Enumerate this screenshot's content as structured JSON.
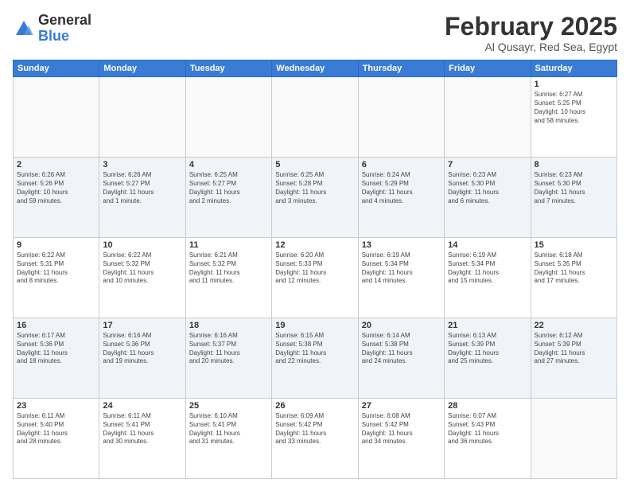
{
  "logo": {
    "general": "General",
    "blue": "Blue"
  },
  "header": {
    "title": "February 2025",
    "subtitle": "Al Qusayr, Red Sea, Egypt"
  },
  "weekdays": [
    "Sunday",
    "Monday",
    "Tuesday",
    "Wednesday",
    "Thursday",
    "Friday",
    "Saturday"
  ],
  "weeks": [
    [
      {
        "day": "",
        "info": ""
      },
      {
        "day": "",
        "info": ""
      },
      {
        "day": "",
        "info": ""
      },
      {
        "day": "",
        "info": ""
      },
      {
        "day": "",
        "info": ""
      },
      {
        "day": "",
        "info": ""
      },
      {
        "day": "1",
        "info": "Sunrise: 6:27 AM\nSunset: 5:25 PM\nDaylight: 10 hours\nand 58 minutes."
      }
    ],
    [
      {
        "day": "2",
        "info": "Sunrise: 6:26 AM\nSunset: 5:26 PM\nDaylight: 10 hours\nand 59 minutes."
      },
      {
        "day": "3",
        "info": "Sunrise: 6:26 AM\nSunset: 5:27 PM\nDaylight: 11 hours\nand 1 minute."
      },
      {
        "day": "4",
        "info": "Sunrise: 6:25 AM\nSunset: 5:27 PM\nDaylight: 11 hours\nand 2 minutes."
      },
      {
        "day": "5",
        "info": "Sunrise: 6:25 AM\nSunset: 5:28 PM\nDaylight: 11 hours\nand 3 minutes."
      },
      {
        "day": "6",
        "info": "Sunrise: 6:24 AM\nSunset: 5:29 PM\nDaylight: 11 hours\nand 4 minutes."
      },
      {
        "day": "7",
        "info": "Sunrise: 6:23 AM\nSunset: 5:30 PM\nDaylight: 11 hours\nand 6 minutes."
      },
      {
        "day": "8",
        "info": "Sunrise: 6:23 AM\nSunset: 5:30 PM\nDaylight: 11 hours\nand 7 minutes."
      }
    ],
    [
      {
        "day": "9",
        "info": "Sunrise: 6:22 AM\nSunset: 5:31 PM\nDaylight: 11 hours\nand 8 minutes."
      },
      {
        "day": "10",
        "info": "Sunrise: 6:22 AM\nSunset: 5:32 PM\nDaylight: 11 hours\nand 10 minutes."
      },
      {
        "day": "11",
        "info": "Sunrise: 6:21 AM\nSunset: 5:32 PM\nDaylight: 11 hours\nand 11 minutes."
      },
      {
        "day": "12",
        "info": "Sunrise: 6:20 AM\nSunset: 5:33 PM\nDaylight: 11 hours\nand 12 minutes."
      },
      {
        "day": "13",
        "info": "Sunrise: 6:19 AM\nSunset: 5:34 PM\nDaylight: 11 hours\nand 14 minutes."
      },
      {
        "day": "14",
        "info": "Sunrise: 6:19 AM\nSunset: 5:34 PM\nDaylight: 11 hours\nand 15 minutes."
      },
      {
        "day": "15",
        "info": "Sunrise: 6:18 AM\nSunset: 5:35 PM\nDaylight: 11 hours\nand 17 minutes."
      }
    ],
    [
      {
        "day": "16",
        "info": "Sunrise: 6:17 AM\nSunset: 5:36 PM\nDaylight: 11 hours\nand 18 minutes."
      },
      {
        "day": "17",
        "info": "Sunrise: 6:16 AM\nSunset: 5:36 PM\nDaylight: 11 hours\nand 19 minutes."
      },
      {
        "day": "18",
        "info": "Sunrise: 6:16 AM\nSunset: 5:37 PM\nDaylight: 11 hours\nand 20 minutes."
      },
      {
        "day": "19",
        "info": "Sunrise: 6:15 AM\nSunset: 5:38 PM\nDaylight: 11 hours\nand 22 minutes."
      },
      {
        "day": "20",
        "info": "Sunrise: 6:14 AM\nSunset: 5:38 PM\nDaylight: 11 hours\nand 24 minutes."
      },
      {
        "day": "21",
        "info": "Sunrise: 6:13 AM\nSunset: 5:39 PM\nDaylight: 11 hours\nand 25 minutes."
      },
      {
        "day": "22",
        "info": "Sunrise: 6:12 AM\nSunset: 5:39 PM\nDaylight: 11 hours\nand 27 minutes."
      }
    ],
    [
      {
        "day": "23",
        "info": "Sunrise: 6:11 AM\nSunset: 5:40 PM\nDaylight: 11 hours\nand 28 minutes."
      },
      {
        "day": "24",
        "info": "Sunrise: 6:11 AM\nSunset: 5:41 PM\nDaylight: 11 hours\nand 30 minutes."
      },
      {
        "day": "25",
        "info": "Sunrise: 6:10 AM\nSunset: 5:41 PM\nDaylight: 11 hours\nand 31 minutes."
      },
      {
        "day": "26",
        "info": "Sunrise: 6:09 AM\nSunset: 5:42 PM\nDaylight: 11 hours\nand 33 minutes."
      },
      {
        "day": "27",
        "info": "Sunrise: 6:08 AM\nSunset: 5:42 PM\nDaylight: 11 hours\nand 34 minutes."
      },
      {
        "day": "28",
        "info": "Sunrise: 6:07 AM\nSunset: 5:43 PM\nDaylight: 11 hours\nand 36 minutes."
      },
      {
        "day": "",
        "info": ""
      }
    ]
  ]
}
